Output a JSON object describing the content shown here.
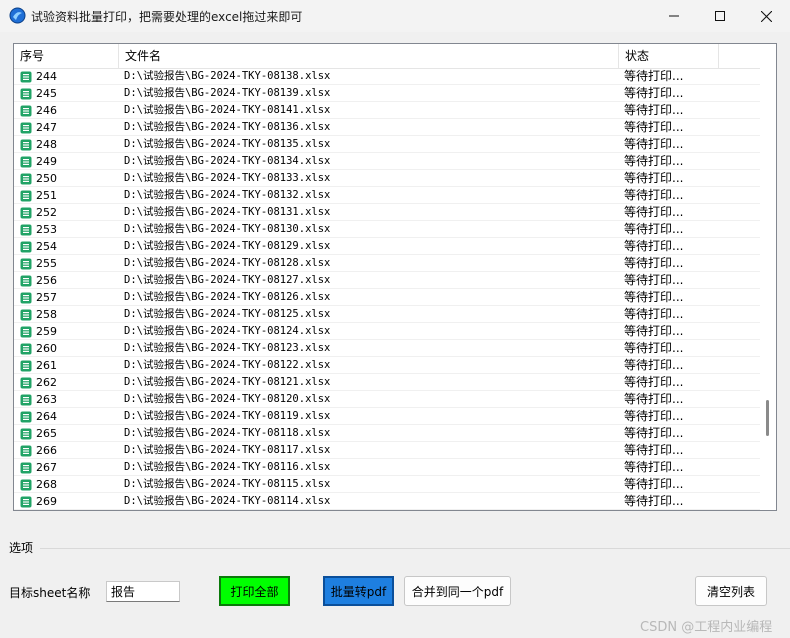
{
  "window": {
    "title": "试验资料批量打印，把需要处理的excel拖过来即可",
    "icon": "app-icon",
    "controls": [
      "minimize-icon",
      "maximize-icon",
      "close-icon"
    ]
  },
  "list": {
    "headers": [
      "序号",
      "文件名",
      "状态",
      ""
    ],
    "rows": [
      {
        "num": "244",
        "file": "D:\\试验报告\\BG-2024-TKY-08138.xlsx",
        "status": "等待打印..."
      },
      {
        "num": "245",
        "file": "D:\\试验报告\\BG-2024-TKY-08139.xlsx",
        "status": "等待打印..."
      },
      {
        "num": "246",
        "file": "D:\\试验报告\\BG-2024-TKY-08141.xlsx",
        "status": "等待打印..."
      },
      {
        "num": "247",
        "file": "D:\\试验报告\\BG-2024-TKY-08136.xlsx",
        "status": "等待打印..."
      },
      {
        "num": "248",
        "file": "D:\\试验报告\\BG-2024-TKY-08135.xlsx",
        "status": "等待打印..."
      },
      {
        "num": "249",
        "file": "D:\\试验报告\\BG-2024-TKY-08134.xlsx",
        "status": "等待打印..."
      },
      {
        "num": "250",
        "file": "D:\\试验报告\\BG-2024-TKY-08133.xlsx",
        "status": "等待打印..."
      },
      {
        "num": "251",
        "file": "D:\\试验报告\\BG-2024-TKY-08132.xlsx",
        "status": "等待打印..."
      },
      {
        "num": "252",
        "file": "D:\\试验报告\\BG-2024-TKY-08131.xlsx",
        "status": "等待打印..."
      },
      {
        "num": "253",
        "file": "D:\\试验报告\\BG-2024-TKY-08130.xlsx",
        "status": "等待打印..."
      },
      {
        "num": "254",
        "file": "D:\\试验报告\\BG-2024-TKY-08129.xlsx",
        "status": "等待打印..."
      },
      {
        "num": "255",
        "file": "D:\\试验报告\\BG-2024-TKY-08128.xlsx",
        "status": "等待打印..."
      },
      {
        "num": "256",
        "file": "D:\\试验报告\\BG-2024-TKY-08127.xlsx",
        "status": "等待打印..."
      },
      {
        "num": "257",
        "file": "D:\\试验报告\\BG-2024-TKY-08126.xlsx",
        "status": "等待打印..."
      },
      {
        "num": "258",
        "file": "D:\\试验报告\\BG-2024-TKY-08125.xlsx",
        "status": "等待打印..."
      },
      {
        "num": "259",
        "file": "D:\\试验报告\\BG-2024-TKY-08124.xlsx",
        "status": "等待打印..."
      },
      {
        "num": "260",
        "file": "D:\\试验报告\\BG-2024-TKY-08123.xlsx",
        "status": "等待打印..."
      },
      {
        "num": "261",
        "file": "D:\\试验报告\\BG-2024-TKY-08122.xlsx",
        "status": "等待打印..."
      },
      {
        "num": "262",
        "file": "D:\\试验报告\\BG-2024-TKY-08121.xlsx",
        "status": "等待打印..."
      },
      {
        "num": "263",
        "file": "D:\\试验报告\\BG-2024-TKY-08120.xlsx",
        "status": "等待打印..."
      },
      {
        "num": "264",
        "file": "D:\\试验报告\\BG-2024-TKY-08119.xlsx",
        "status": "等待打印..."
      },
      {
        "num": "265",
        "file": "D:\\试验报告\\BG-2024-TKY-08118.xlsx",
        "status": "等待打印..."
      },
      {
        "num": "266",
        "file": "D:\\试验报告\\BG-2024-TKY-08117.xlsx",
        "status": "等待打印..."
      },
      {
        "num": "267",
        "file": "D:\\试验报告\\BG-2024-TKY-08116.xlsx",
        "status": "等待打印..."
      },
      {
        "num": "268",
        "file": "D:\\试验报告\\BG-2024-TKY-08115.xlsx",
        "status": "等待打印..."
      },
      {
        "num": "269",
        "file": "D:\\试验报告\\BG-2024-TKY-08114.xlsx",
        "status": "等待打印..."
      }
    ],
    "row_icon": "excel-file-icon"
  },
  "options": {
    "group_label": "选项",
    "sheet_label": "目标sheet名称",
    "sheet_value": "报告"
  },
  "buttons": {
    "print_all": "打印全部",
    "batch_pdf": "批量转pdf",
    "merge_pdf": "合并到同一个pdf",
    "clear_list": "清空列表"
  },
  "watermark": "CSDN @工程内业编程",
  "colors": {
    "print_button": "#00ff00",
    "pdf_button": "#1e7fe0",
    "excel_icon": "#21a366"
  }
}
